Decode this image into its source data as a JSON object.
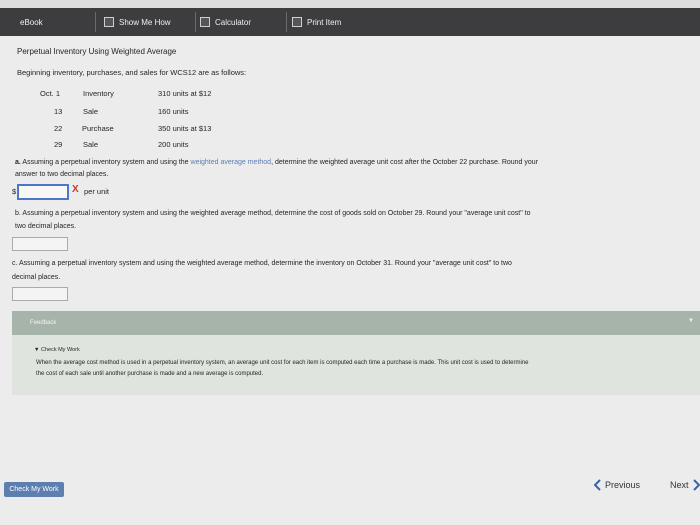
{
  "toolbar": {
    "ebook": "eBook",
    "show_me_how": "Show Me How",
    "calculator": "Calculator",
    "print_item": "Print Item"
  },
  "problem": {
    "title": "Perpetual Inventory Using Weighted Average",
    "intro": "Beginning inventory, purchases, and sales for WCS12 are as follows:",
    "rows": [
      {
        "date": "Oct. 1",
        "type": "Inventory",
        "detail": "310 units at $12"
      },
      {
        "date": "13",
        "type": "Sale",
        "detail": "160 units"
      },
      {
        "date": "22",
        "type": "Purchase",
        "detail": "350 units at $13"
      },
      {
        "date": "29",
        "type": "Sale",
        "detail": "200 units"
      }
    ]
  },
  "part_a": {
    "label": "a.",
    "text_before": "Assuming a perpetual inventory system and using the",
    "link": "weighted average method",
    "text_after": ", determine the weighted average unit cost after the October 22 purchase. Round your",
    "text_line2": "answer to two decimal places.",
    "currency": "$",
    "unit": "per unit",
    "status_mark": "X"
  },
  "part_b": {
    "line1": "b.  Assuming a perpetual inventory system and using the weighted average method, determine the cost of goods sold on October 29. Round your \"average unit cost\" to",
    "line2": "two decimal places.",
    "currency": "$"
  },
  "part_c": {
    "line1": "c.  Assuming a perpetual inventory system and using the weighted average method, determine the inventory on October 31. Round your \"average unit cost\" to two",
    "line2": "decimal places.",
    "currency": "$"
  },
  "feedback": {
    "heading": "Feedback",
    "check_label": "Check My Work",
    "line1": "When the average cost method is used in a perpetual inventory system, an average unit cost for each item is computed each time a purchase is made. This unit cost is used to determine",
    "line2": "the cost of each sale until another purchase is made and a new average is computed."
  },
  "footer": {
    "check_button": "Check My Work",
    "previous": "Previous",
    "next": "Next"
  },
  "colors": {
    "toolbar_bg": "#3d3d3f",
    "accent_blue": "#4a78c6",
    "error_red": "#d0342c",
    "feedback_header": "#a7b4a9"
  }
}
